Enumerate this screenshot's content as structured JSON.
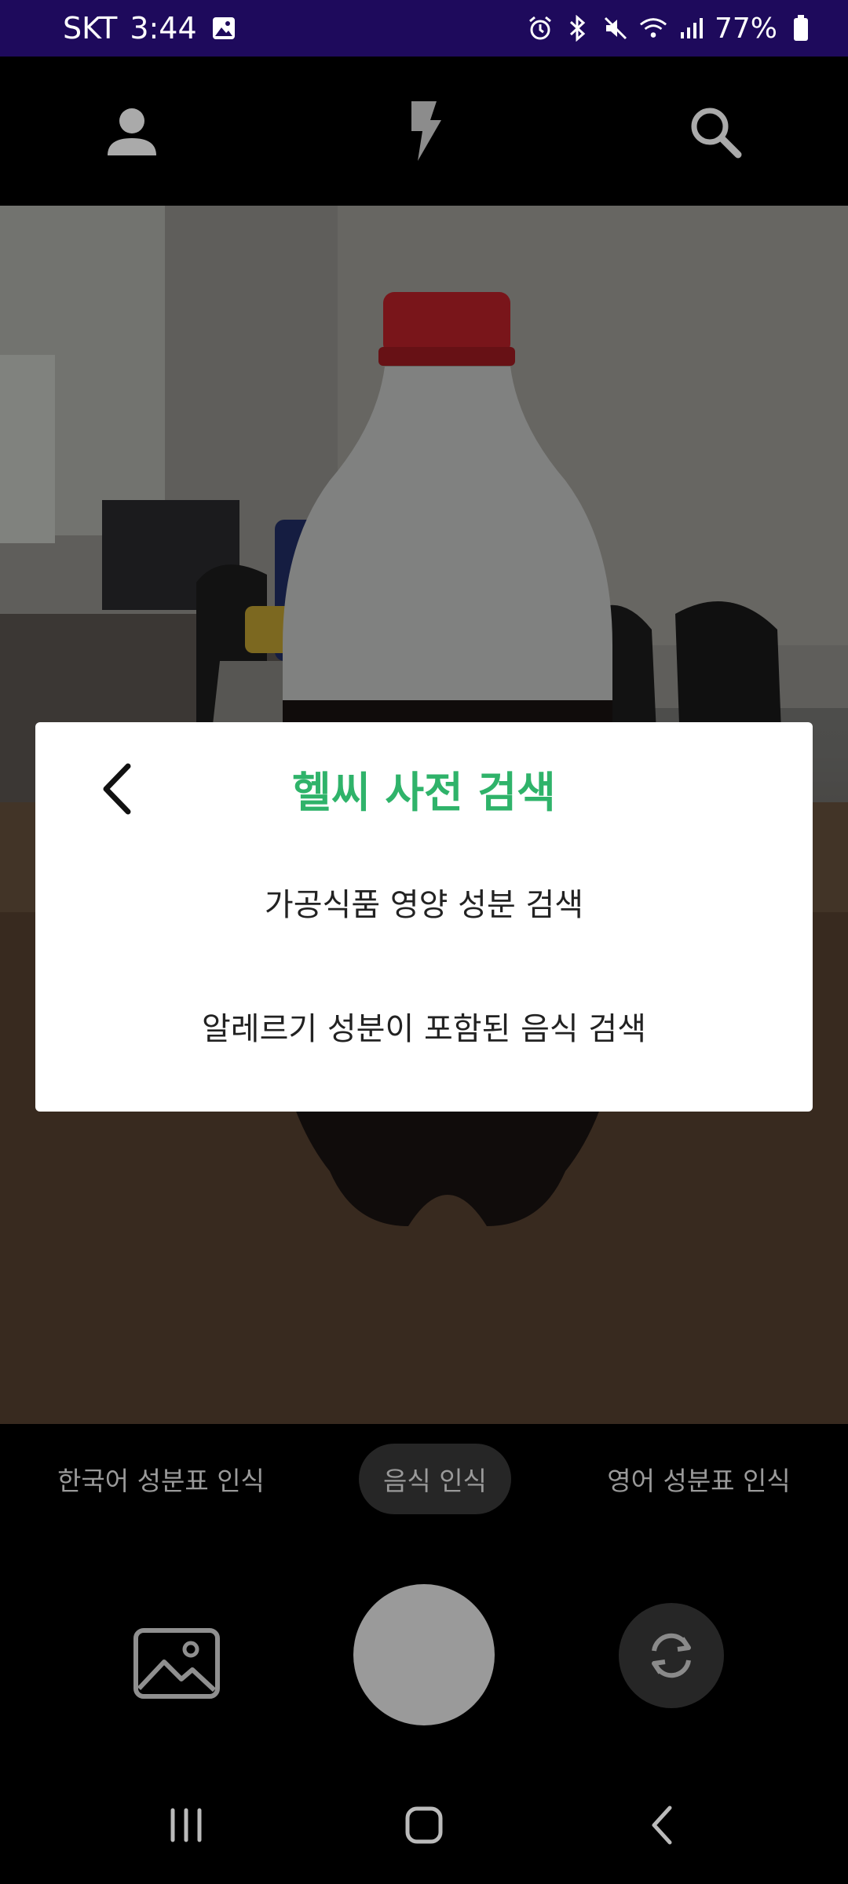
{
  "status_bar": {
    "carrier": "SKT",
    "time": "3:44",
    "battery": "77%",
    "icons": [
      "gallery-notification-icon",
      "alarm-icon",
      "bluetooth-icon",
      "mute-icon",
      "wifi-icon",
      "signal-icon",
      "battery-icon"
    ]
  },
  "top_bar": {
    "icons": [
      "profile-icon",
      "flash-icon",
      "search-icon"
    ]
  },
  "dialog": {
    "title": "헬씨 사전 검색",
    "items": [
      {
        "label": "가공식품 영양 성분 검색"
      },
      {
        "label": "알레르기 성분이 포함된 음식 검색"
      }
    ]
  },
  "modes": [
    {
      "label": "한국어 성분표 인식",
      "active": false
    },
    {
      "label": "음식 인식",
      "active": true
    },
    {
      "label": "영어 성분표 인식",
      "active": false
    }
  ],
  "controls": {
    "icons": [
      "gallery-icon",
      "shutter",
      "camera-switch-icon"
    ]
  },
  "nav_bar": {
    "icons": [
      "recent-apps-icon",
      "home-icon",
      "back-icon"
    ]
  },
  "colors": {
    "status_bar_bg": "#1e0a5c",
    "accent_green": "#2fb36a",
    "mode_active_bg": "#262626",
    "shutter": "#9a9a9a"
  }
}
